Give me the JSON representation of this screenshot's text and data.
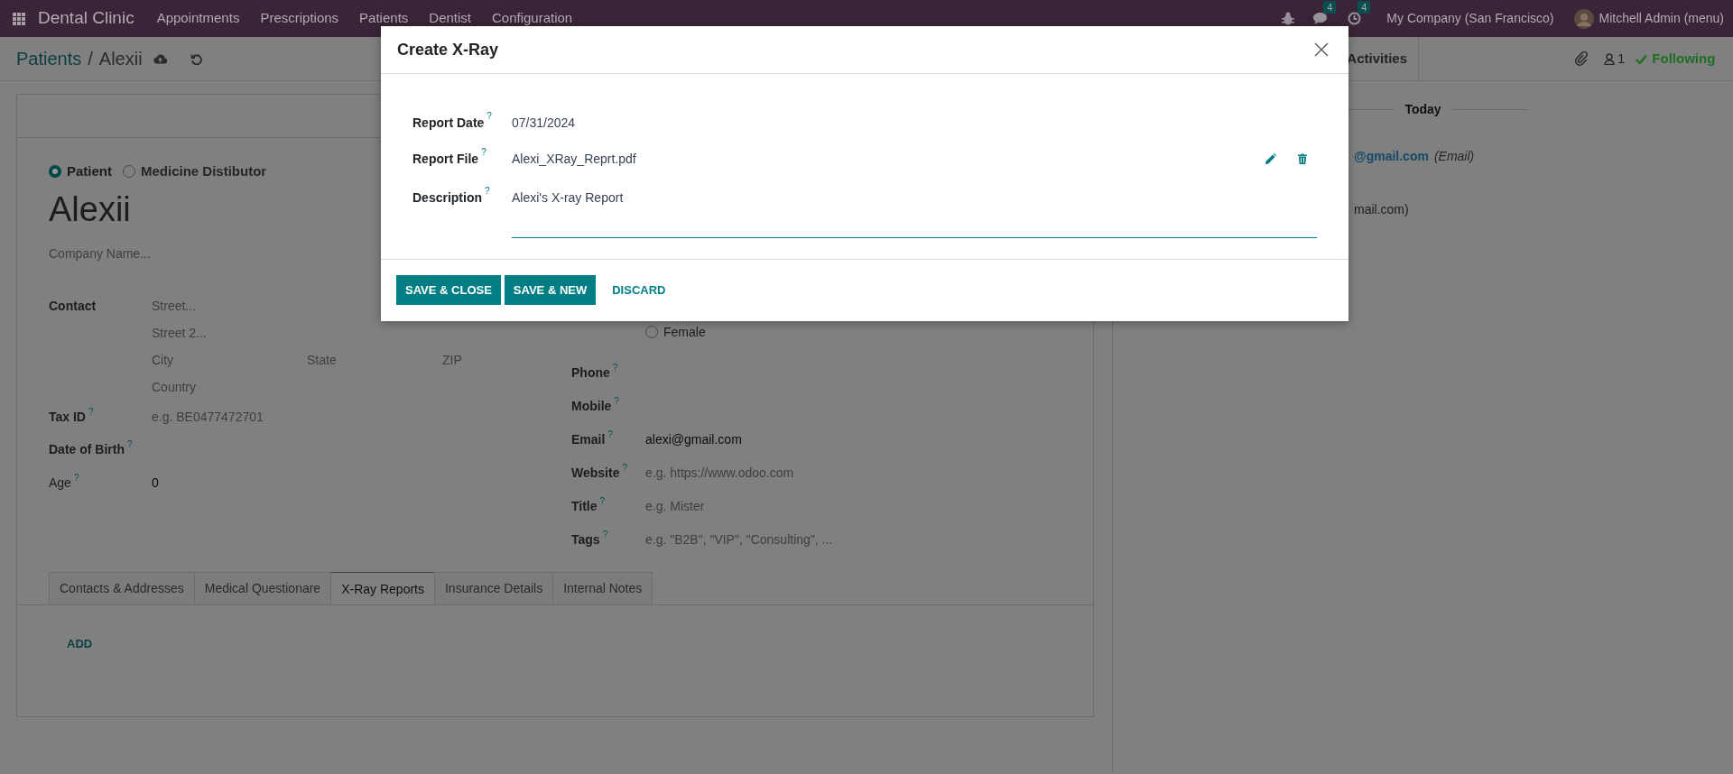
{
  "navbar": {
    "app_name": "Dental Clinic",
    "menu": [
      "Appointments",
      "Prescriptions",
      "Patients",
      "Dentist",
      "Configuration"
    ],
    "messages_count": "4",
    "activities_count": "4",
    "company": "My Company (San Francisco)",
    "user": "Mitchell Admin (menu)"
  },
  "breadcrumb": {
    "parent": "Patients",
    "separator": "/",
    "current": "Alexii"
  },
  "chatter_toolbar": {
    "activities": "Activities",
    "followers_count": "1",
    "following": "Following"
  },
  "form": {
    "partner_types": [
      {
        "label": "Patient",
        "selected": true
      },
      {
        "label": "Medicine Distibutor",
        "selected": false
      }
    ],
    "name": "Alexii",
    "company_placeholder": "Company Name...",
    "address": {
      "label": "Contact",
      "street": "Street...",
      "street2": "Street 2...",
      "city": "City",
      "state": "State",
      "zip": "ZIP",
      "country": "Country"
    },
    "left_fields": [
      {
        "label": "Tax ID",
        "help": "?",
        "bold": true,
        "placeholder": "e.g. BE0477472701"
      },
      {
        "label": "Date of Birth",
        "help": "?",
        "bold": true
      },
      {
        "label": "Age",
        "help": "?",
        "bold": false,
        "value": "0"
      }
    ],
    "gender": [
      {
        "label": "Female",
        "selected": false
      }
    ],
    "right_fields": [
      {
        "label": "Phone",
        "help": "?"
      },
      {
        "label": "Mobile",
        "help": "?"
      },
      {
        "label": "Email",
        "help": "?",
        "value": "alexi@gmail.com"
      },
      {
        "label": "Website",
        "help": "?",
        "placeholder": "e.g. https://www.odoo.com"
      },
      {
        "label": "Title",
        "help": "?",
        "placeholder": "e.g. Mister"
      },
      {
        "label": "Tags",
        "help": "?",
        "placeholder": "e.g. \"B2B\", \"VIP\", \"Consulting\", ..."
      }
    ]
  },
  "tabs": [
    {
      "label": "Contacts & Addresses",
      "selected": false
    },
    {
      "label": "Medical Questionare",
      "selected": false
    },
    {
      "label": "X-Ray Reports",
      "selected": true
    },
    {
      "label": "Insurance Details",
      "selected": false
    },
    {
      "label": "Internal Notes",
      "selected": false
    }
  ],
  "add_button": "ADD",
  "chatter": {
    "day": "Today",
    "messages": [
      {
        "link": "@gmail.com",
        "note": "(Email)"
      },
      {
        "text": "mail.com)"
      }
    ]
  },
  "modal": {
    "title": "Create X-Ray",
    "fields": [
      {
        "kind": "date",
        "label": "Report Date",
        "help": "?",
        "value": "07/31/2024"
      },
      {
        "kind": "file",
        "label": "Report File",
        "help": "?",
        "value": "Alexi_XRay_Reprt.pdf"
      },
      {
        "kind": "textarea",
        "label": "Description",
        "help": "?",
        "value": "Alexi's X-ray Report"
      }
    ],
    "buttons": [
      {
        "kind": "primary",
        "label": "SAVE & CLOSE"
      },
      {
        "kind": "primary",
        "label": "SAVE & NEW"
      },
      {
        "kind": "link",
        "label": "DISCARD"
      }
    ]
  }
}
